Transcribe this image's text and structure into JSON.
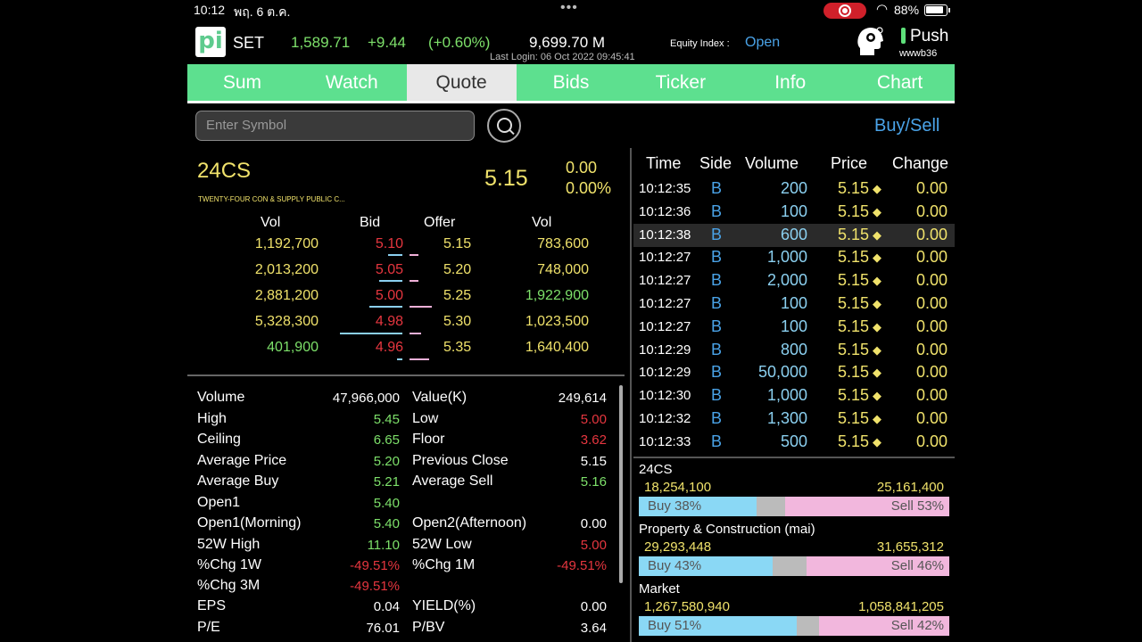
{
  "status": {
    "time": "10:12",
    "date": "พฤ. 6 ต.ค.",
    "dots": "•••",
    "battery": "88%"
  },
  "header": {
    "logo": "pi",
    "market": "SET",
    "index": "1,589.71",
    "change": "+9.44",
    "percent": "(+0.60%)",
    "value": "9,699.70 M",
    "equity_label": "Equity Index :",
    "equity_status": "Open",
    "last_login": "Last Login: 06 Oct 2022 09:45:41",
    "push": "Push",
    "user": "wwwb36"
  },
  "tabs": [
    "Sum",
    "Watch",
    "Quote",
    "Bids",
    "Ticker",
    "Info",
    "Chart"
  ],
  "search": {
    "placeholder": "Enter Symbol",
    "buysell": "Buy/Sell"
  },
  "quote": {
    "symbol": "24CS",
    "fullname": "TWENTY-FOUR CON & SUPPLY PUBLIC C...",
    "last": "5.15",
    "change": "0.00",
    "percent": "0.00%"
  },
  "bidoffer": {
    "headers": [
      "Vol",
      "Bid",
      "Offer",
      "Vol"
    ],
    "rows": [
      {
        "bvol": "1,192,700",
        "bid": "5.10",
        "offer": "5.15",
        "ovol": "783,600"
      },
      {
        "bvol": "2,013,200",
        "bid": "5.05",
        "offer": "5.20",
        "ovol": "748,000"
      },
      {
        "bvol": "2,881,200",
        "bid": "5.00",
        "offer": "5.25",
        "ovol": "1,922,900"
      },
      {
        "bvol": "5,328,300",
        "bid": "4.98",
        "offer": "5.30",
        "ovol": "1,023,500"
      },
      {
        "bvol": "401,900",
        "bid": "4.96",
        "offer": "5.35",
        "ovol": "1,640,400"
      }
    ]
  },
  "stats": {
    "left": [
      {
        "label": "Volume",
        "value": "47,966,000"
      },
      {
        "label": "High",
        "value": "5.45"
      },
      {
        "label": "Ceiling",
        "value": "6.65"
      },
      {
        "label": "Average Price",
        "value": "5.20"
      },
      {
        "label": "Average Buy",
        "value": "5.21"
      },
      {
        "label": "Open1",
        "value": "5.40"
      },
      {
        "label": "Open1(Morning)",
        "value": "5.40"
      },
      {
        "label": "52W High",
        "value": "11.10"
      },
      {
        "label": "%Chg 1W",
        "value": "-49.51%"
      },
      {
        "label": "%Chg 3M",
        "value": "-49.51%"
      },
      {
        "label": "EPS",
        "value": "0.04"
      },
      {
        "label": "P/E",
        "value": "76.01"
      }
    ],
    "right": [
      {
        "label": "Value(K)",
        "value": "249,614"
      },
      {
        "label": "Low",
        "value": "5.00"
      },
      {
        "label": "Floor",
        "value": "3.62"
      },
      {
        "label": "Previous Close",
        "value": "5.15"
      },
      {
        "label": "Average Sell",
        "value": "5.16"
      },
      {
        "label": "",
        "value": ""
      },
      {
        "label": "Open2(Afternoon)",
        "value": "0.00"
      },
      {
        "label": "52W Low",
        "value": "5.00"
      },
      {
        "label": "%Chg 1M",
        "value": "-49.51%"
      },
      {
        "label": "",
        "value": ""
      },
      {
        "label": "YIELD(%)",
        "value": "0.00"
      },
      {
        "label": "P/BV",
        "value": "3.64"
      }
    ]
  },
  "ticker": {
    "headers": [
      "Time",
      "Side",
      "Volume",
      "Price",
      "Change"
    ],
    "rows": [
      {
        "time": "10:12:35",
        "side": "B",
        "volume": "200",
        "price": "5.15",
        "change": "0.00"
      },
      {
        "time": "10:12:36",
        "side": "B",
        "volume": "100",
        "price": "5.15",
        "change": "0.00"
      },
      {
        "time": "10:12:38",
        "side": "B",
        "volume": "600",
        "price": "5.15",
        "change": "0.00"
      },
      {
        "time": "10:12:27",
        "side": "B",
        "volume": "1,000",
        "price": "5.15",
        "change": "0.00"
      },
      {
        "time": "10:12:27",
        "side": "B",
        "volume": "2,000",
        "price": "5.15",
        "change": "0.00"
      },
      {
        "time": "10:12:27",
        "side": "B",
        "volume": "100",
        "price": "5.15",
        "change": "0.00"
      },
      {
        "time": "10:12:27",
        "side": "B",
        "volume": "100",
        "price": "5.15",
        "change": "0.00"
      },
      {
        "time": "10:12:29",
        "side": "B",
        "volume": "800",
        "price": "5.15",
        "change": "0.00"
      },
      {
        "time": "10:12:29",
        "side": "B",
        "volume": "50,000",
        "price": "5.15",
        "change": "0.00"
      },
      {
        "time": "10:12:30",
        "side": "B",
        "volume": "1,000",
        "price": "5.15",
        "change": "0.00"
      },
      {
        "time": "10:12:32",
        "side": "B",
        "volume": "1,300",
        "price": "5.15",
        "change": "0.00"
      },
      {
        "time": "10:12:33",
        "side": "B",
        "volume": "500",
        "price": "5.15",
        "change": "0.00"
      }
    ]
  },
  "groups": [
    {
      "name": "24CS",
      "buy_vol": "18,254,100",
      "sell_vol": "25,161,400",
      "buy_label": "Buy 38%",
      "sell_label": "Sell 53%",
      "buy_pct": 38,
      "sell_pct": 53
    },
    {
      "name": "Property & Construction (mai)",
      "buy_vol": "29,293,448",
      "sell_vol": "31,655,312",
      "buy_label": "Buy 43%",
      "sell_label": "Sell 46%",
      "buy_pct": 43,
      "sell_pct": 46
    },
    {
      "name": "Market",
      "buy_vol": "1,267,580,940",
      "sell_vol": "1,058,841,205",
      "buy_label": "Buy 51%",
      "sell_label": "Sell 42%",
      "buy_pct": 51,
      "sell_pct": 42
    }
  ]
}
